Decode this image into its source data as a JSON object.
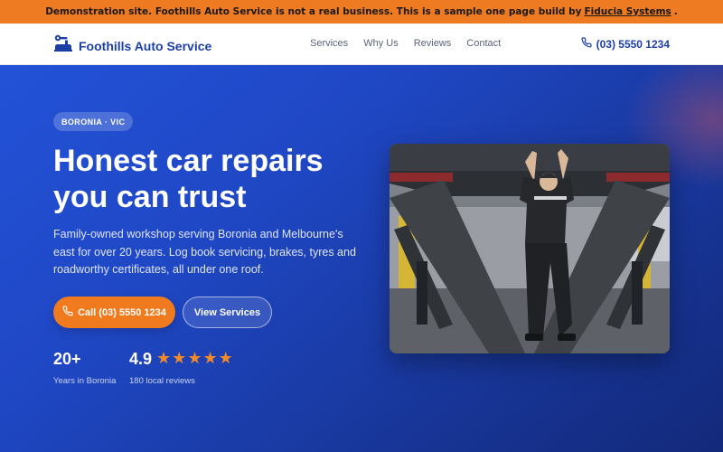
{
  "banner": {
    "text": "Demonstration site. Foothills Auto Service is not a real business. This is a sample one page build by",
    "link": "Fiducia Systems",
    "end": "."
  },
  "nav": {
    "brand": "Foothills Auto Service",
    "links": [
      "Services",
      "Why Us",
      "Reviews",
      "Contact"
    ],
    "phone": "(03) 5550 1234"
  },
  "hero": {
    "badge": "BORONIA · VIC",
    "headline": [
      "Honest car repairs",
      "you can trust"
    ],
    "lead": "Family-owned workshop serving Boronia and Melbourne's east for over 20 years. Log book servicing, brakes, tyres and roadworthy certificates, all under one roof.",
    "cta_primary": "Call (03) 5550 1234",
    "cta_secondary": "View Services",
    "stats": [
      {
        "value": "20+",
        "label": "Years in Boronia"
      },
      {
        "value": "4.9",
        "label": "180 local reviews",
        "stars": 5
      }
    ]
  },
  "colors": {
    "accent": "#ee7a22",
    "brand": "#1c3fa6",
    "hero_top": "#2352d8",
    "hero_bottom": "#13297a"
  },
  "icons": {
    "brand": "wrench-car-icon",
    "phone": "phone-icon",
    "star": "star-icon"
  }
}
